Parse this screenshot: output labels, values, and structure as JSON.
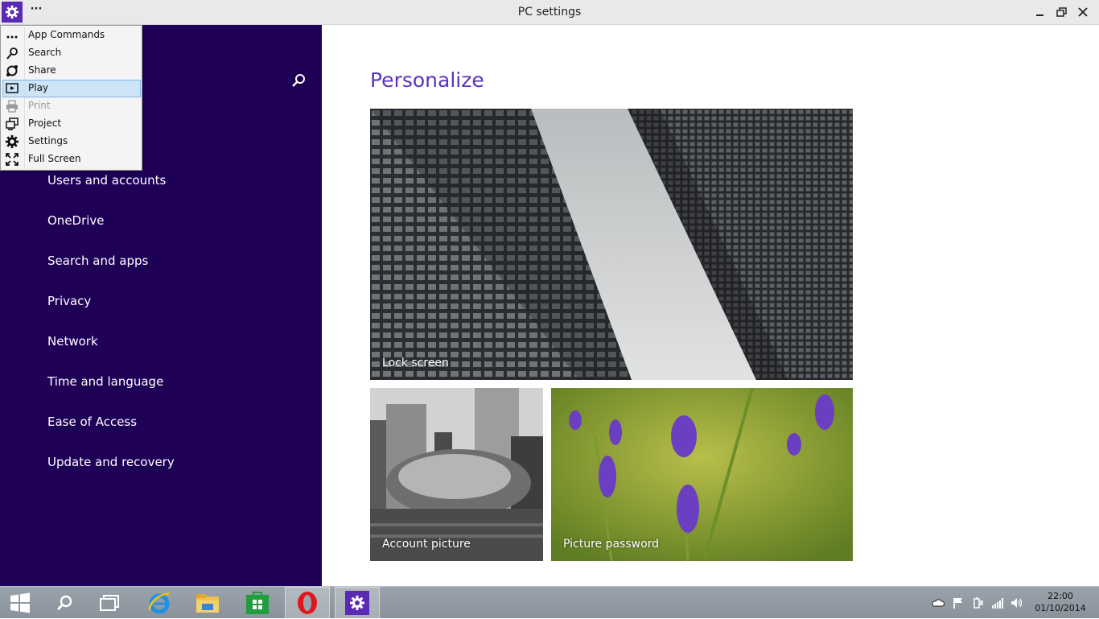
{
  "window": {
    "title": "PC settings",
    "overflow_label": "···"
  },
  "menu": {
    "items": [
      {
        "label": "App Commands",
        "icon": "more-icon",
        "state": "normal"
      },
      {
        "label": "Search",
        "icon": "search-icon",
        "state": "normal"
      },
      {
        "label": "Share",
        "icon": "share-icon",
        "state": "normal"
      },
      {
        "label": "Play",
        "icon": "play-icon",
        "state": "highlighted"
      },
      {
        "label": "Print",
        "icon": "print-icon",
        "state": "disabled"
      },
      {
        "label": "Project",
        "icon": "project-icon",
        "state": "normal"
      },
      {
        "label": "Settings",
        "icon": "gear-icon",
        "state": "normal"
      },
      {
        "label": "Full Screen",
        "icon": "fullscreen-icon",
        "state": "normal"
      }
    ]
  },
  "sidebar": {
    "items": [
      {
        "label": "Users and accounts"
      },
      {
        "label": "OneDrive"
      },
      {
        "label": "Search and apps"
      },
      {
        "label": "Privacy"
      },
      {
        "label": "Network"
      },
      {
        "label": "Time and language"
      },
      {
        "label": "Ease of Access"
      },
      {
        "label": "Update and recovery"
      }
    ]
  },
  "main": {
    "title": "Personalize",
    "tiles": [
      {
        "label": "Lock screen"
      },
      {
        "label": "Account picture"
      },
      {
        "label": "Picture password"
      }
    ]
  },
  "taskbar": {
    "apps": [
      "start-icon",
      "search-icon",
      "task-view-icon",
      "internet-explorer-icon",
      "file-explorer-icon",
      "store-icon",
      "opera-icon",
      "pc-settings-icon"
    ],
    "tray": [
      "onedrive-icon",
      "action-center-flag-icon",
      "power-icon",
      "network-icon",
      "volume-icon"
    ],
    "clock": {
      "time": "22:00",
      "date": "01/10/2014"
    }
  },
  "colors": {
    "accent": "#5b32c1",
    "sidebar": "#1f0057",
    "app_tile": "#5a2ab5"
  }
}
